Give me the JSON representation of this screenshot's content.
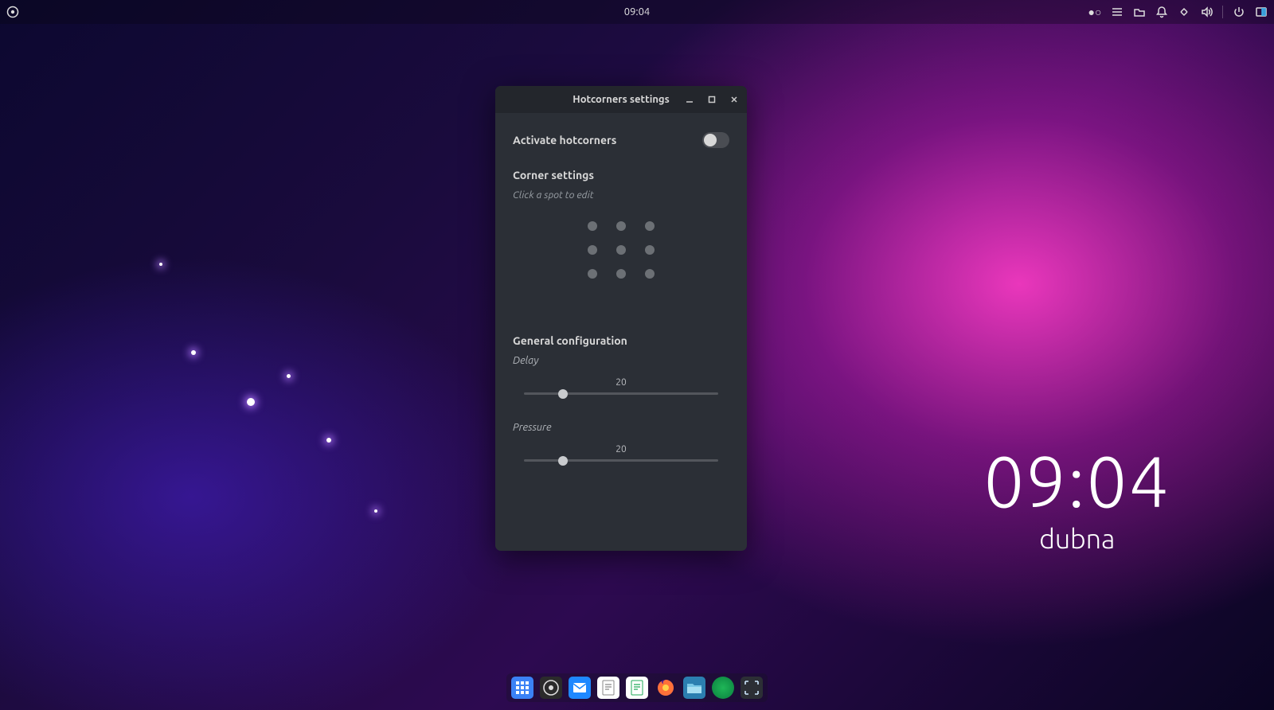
{
  "panel": {
    "time": "09:04"
  },
  "desktop_clock": {
    "time": "09:04",
    "date": "dubna"
  },
  "window": {
    "title": "Hotcorners settings",
    "activate_label": "Activate hotcorners",
    "activate_on": false,
    "corner_section": "Corner settings",
    "corner_hint": "Click a spot to edit",
    "general_section": "General configuration",
    "delay": {
      "label": "Delay",
      "value": "20",
      "percent": 20
    },
    "pressure": {
      "label": "Pressure",
      "value": "20",
      "percent": 20
    }
  },
  "dock": {
    "items": [
      {
        "name": "app-grid",
        "bg": "#3b82f6"
      },
      {
        "name": "budgie-logo",
        "bg": "#2f2f2f"
      },
      {
        "name": "mail",
        "bg": "#1e88ff"
      },
      {
        "name": "document",
        "bg": "#ffffff"
      },
      {
        "name": "writer",
        "bg": "#ffffff"
      },
      {
        "name": "firefox",
        "bg": "transparent"
      },
      {
        "name": "files",
        "bg": "#2b7fb0"
      },
      {
        "name": "terminal",
        "bg": "#0a7f3f"
      },
      {
        "name": "screenshot",
        "bg": "#2c2f35"
      }
    ]
  }
}
